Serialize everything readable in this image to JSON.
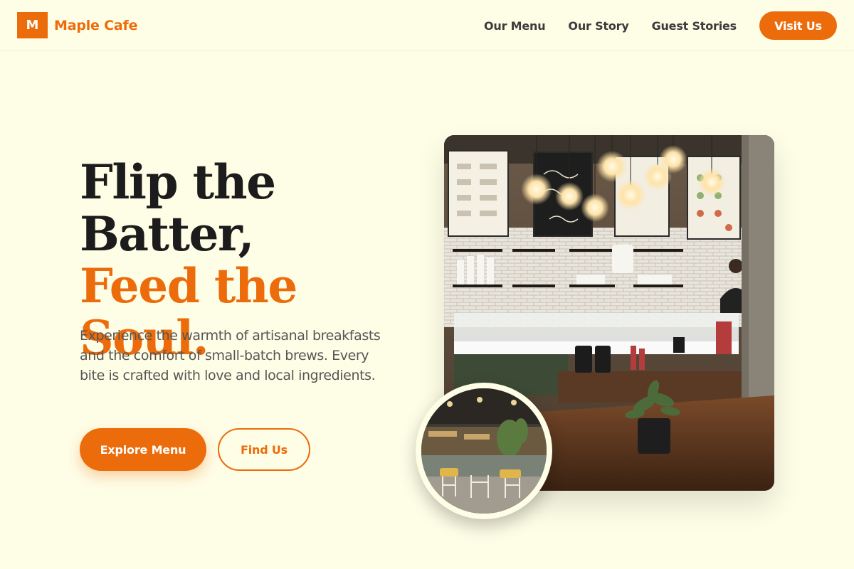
{
  "header": {
    "logo_mark": "M",
    "logo_text": "Maple Cafe",
    "nav": [
      {
        "label": "Our Menu"
      },
      {
        "label": "Our Story"
      },
      {
        "label": "Guest Stories"
      }
    ],
    "cta_label": "Visit Us"
  },
  "hero": {
    "title_line1": "Flip the",
    "title_line2": "Batter,",
    "title_accent": "Feed the Soul.",
    "description": "Experience the warmth of artisanal breakfasts and the comfort of small-batch brews. Every bite is crafted with love and local ingredients.",
    "primary_button": "Explore Menu",
    "secondary_button": "Find Us"
  },
  "colors": {
    "accent": "#ec6c0b",
    "background": "#fefde6",
    "heading": "#1c1c1c"
  },
  "images": {
    "main": "cafe-counter-photo",
    "inset": "cafe-interior-photo"
  }
}
